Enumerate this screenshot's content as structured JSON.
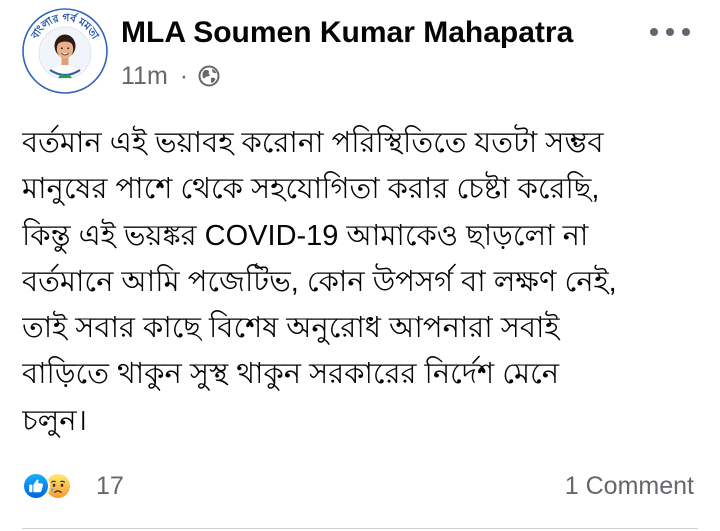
{
  "post": {
    "author": "MLA Soumen Kumar Mahapatra",
    "avatar": {
      "logo_text": "বাংলার গর্ব মমতা"
    },
    "timestamp": "11m",
    "separator": "·",
    "privacy_icon": "globe-icon",
    "more_icon": "more-horizontal-icon",
    "body_lines": [
      "বর্তমান এই ভয়াবহ করোনা পরিস্থিতিতে যতটা সম্ভব",
      "মানুষের পাশে থেকে সহযোগিতা করার চেষ্টা করেছি,",
      "কিন্তু এই ভয়ঙ্কর COVID-19 আমাকেও ছাড়লো না",
      "বর্তমানে আমি পজেটিভ, কোন উপসর্গ বা লক্ষণ নেই,",
      "তাই সবার কাছে বিশেষ অনুরোধ আপনারা সবাই",
      "বাড়িতে থাকুন সুস্থ থাকুন সরকারের নির্দেশ মেনে",
      "চলুন।"
    ],
    "reactions": {
      "icons": [
        "like-reaction-icon",
        "sad-reaction-icon"
      ],
      "count": "17"
    },
    "comment_count_label": "1 Comment"
  },
  "colors": {
    "text-primary": "#050505",
    "text-secondary": "#65676b",
    "like-blue": "#1877f2",
    "divider": "#ced0d4"
  }
}
